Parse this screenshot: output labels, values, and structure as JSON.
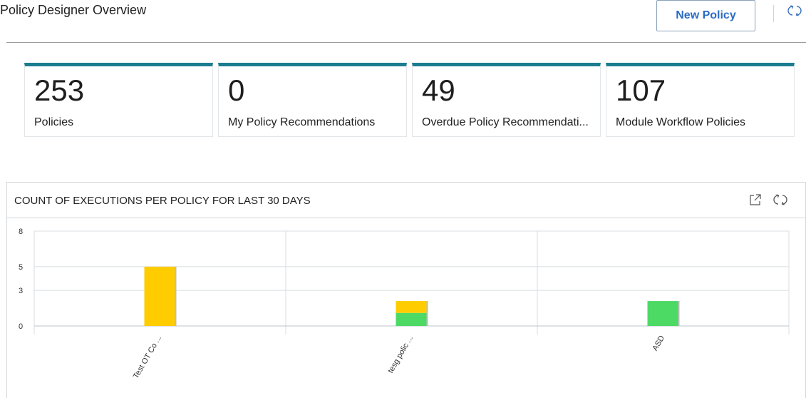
{
  "header": {
    "title": "Policy Designer Overview",
    "new_policy_label": "New Policy",
    "refresh_icon": "refresh-icon"
  },
  "kpis": [
    {
      "value": "253",
      "label": "Policies"
    },
    {
      "value": "0",
      "label": "My Policy Recommendations"
    },
    {
      "value": "49",
      "label": "Overdue Policy Recommendati..."
    },
    {
      "value": "107",
      "label": "Module Workflow Policies"
    }
  ],
  "colors": {
    "accent": "#1b7d8f",
    "button_text": "#2b6cc4",
    "series_yellow": "#ffcc00",
    "series_green": "#4cd964"
  },
  "chart": {
    "title": "COUNT OF EXECUTIONS PER POLICY FOR LAST 30 DAYS",
    "expand_icon": "external-link-icon",
    "refresh_icon": "refresh-icon"
  },
  "chart_data": {
    "type": "bar",
    "stacked": true,
    "categories": [
      "Test OT Co ...",
      "tesg polic ...",
      "ASD"
    ],
    "series": [
      {
        "color": "#4cd964",
        "values": [
          0,
          1.1,
          2.1
        ]
      },
      {
        "color": "#ffcc00",
        "values": [
          5.0,
          1.0,
          0
        ]
      }
    ],
    "y_tick_labels": [
      "0",
      "3",
      "5",
      "8"
    ],
    "ylim": [
      0,
      8
    ],
    "grid": true,
    "legend": "none"
  }
}
